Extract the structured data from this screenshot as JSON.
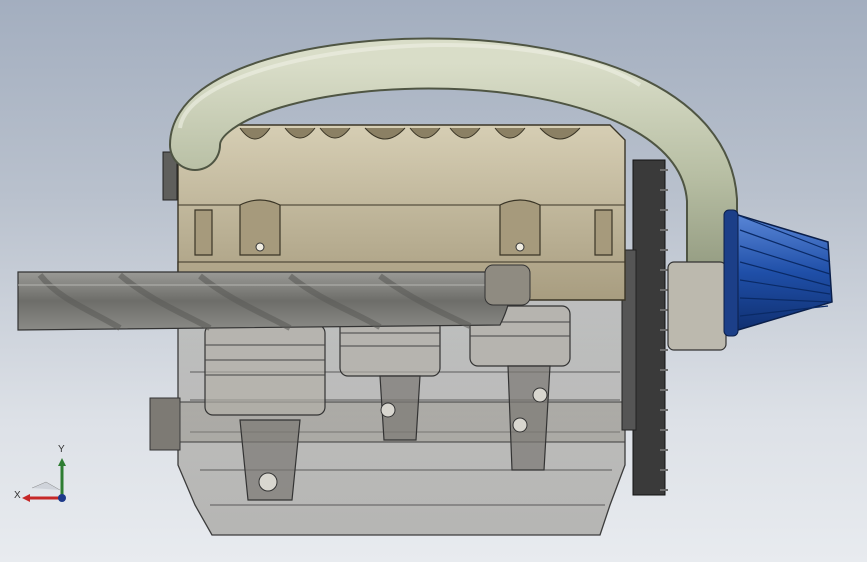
{
  "viewport": {
    "background_top": "#a3aebf",
    "background_bottom": "#e8ebef"
  },
  "triad": {
    "x_label": "X",
    "y_label": "Y",
    "x_color": "#c62828",
    "y_color": "#2e7d32",
    "z_color": "#1e3a8a"
  },
  "model": {
    "head_color": "#c9bfa3",
    "hose_color": "#b9c0a6",
    "air_filter_color": "#2a5fb5",
    "exhaust_color": "#7c7c78",
    "block_line_color": "#3c3c3c"
  }
}
